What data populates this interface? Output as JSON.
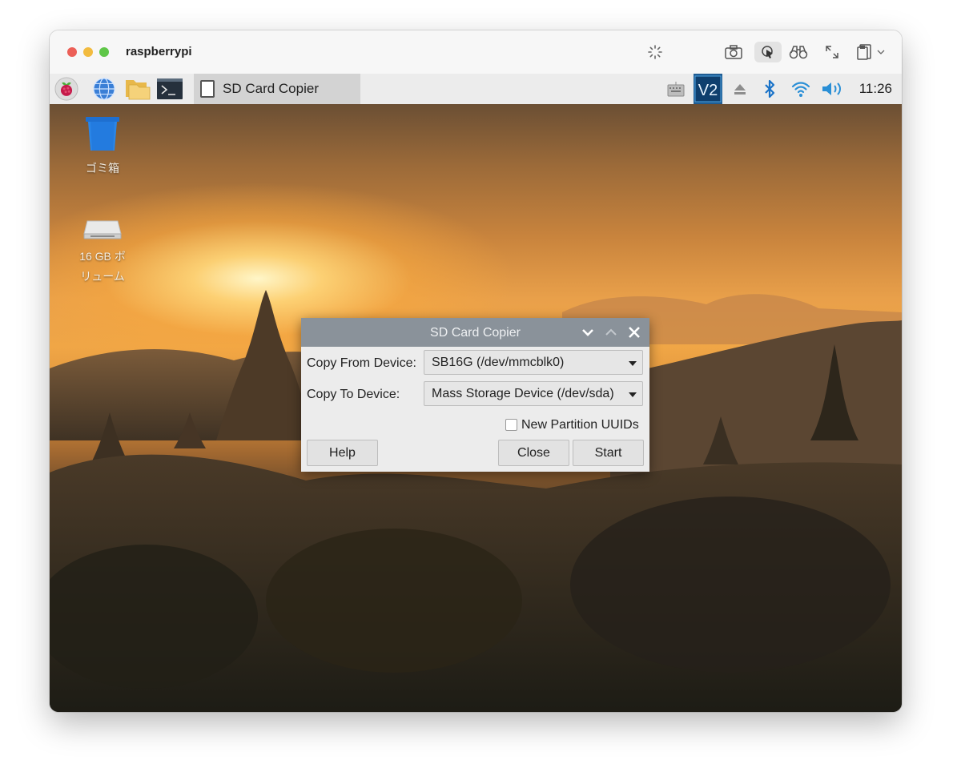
{
  "window": {
    "title": "raspberrypi"
  },
  "titlebar_icons": [
    "loading-spinner-icon",
    "camera-icon",
    "pointer-icon",
    "binoculars-icon",
    "expand-icon",
    "clipboard-icon",
    "chevron-down-icon"
  ],
  "taskbar": {
    "launchers": [
      "raspberry-menu-icon",
      "web-browser-icon",
      "file-manager-icon",
      "terminal-icon"
    ],
    "active_task": "SD Card Copier",
    "tray": [
      "keyboard-icon",
      "vnc-icon",
      "eject-icon",
      "bluetooth-icon",
      "wifi-icon",
      "volume-icon"
    ],
    "clock": "11:26"
  },
  "desktop": {
    "icons": [
      {
        "label": "ゴミ箱",
        "icon": "trash-icon"
      },
      {
        "label_line1": "16 GB ボ",
        "label_line2": "リューム",
        "icon": "drive-icon"
      }
    ]
  },
  "dialog": {
    "title": "SD Card Copier",
    "from_label": "Copy From Device:",
    "from_value": "SB16G  (/dev/mmcblk0)",
    "to_label": "Copy To Device:",
    "to_value": "Mass Storage Device  (/dev/sda)",
    "uuid_label": "New Partition UUIDs",
    "uuid_checked": false,
    "help_label": "Help",
    "close_label": "Close",
    "start_label": "Start"
  },
  "colors": {
    "dialog_title_bar": "#8a929a",
    "vnc_icon_bg": "#1f5d94",
    "bluetooth": "#1a73c8",
    "wifi": "#2a8fd6"
  }
}
